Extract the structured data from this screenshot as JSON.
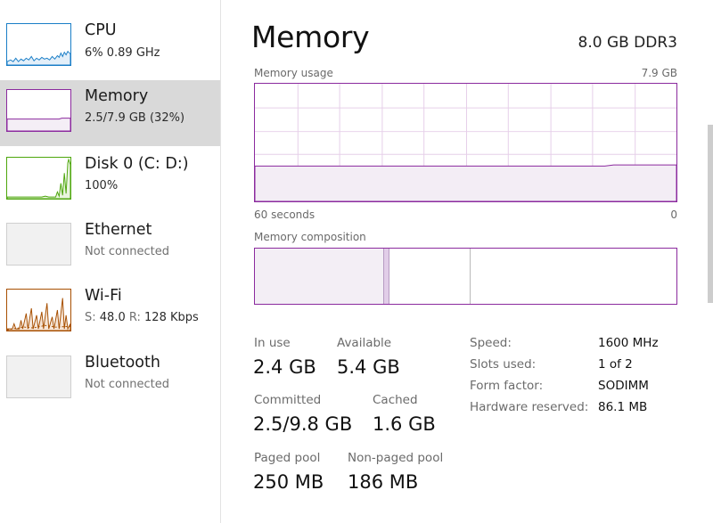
{
  "sidebar": {
    "items": [
      {
        "name": "CPU",
        "sub": "6%  0.89 GHz",
        "color": "#1a7ec7"
      },
      {
        "name": "Memory",
        "sub": "2.5/7.9 GB (32%)",
        "color": "#8b2a9e",
        "selected": true
      },
      {
        "name": "Disk 0 (C: D:)",
        "sub": "100%",
        "color": "#4da60c"
      },
      {
        "name": "Ethernet",
        "sub": "Not connected",
        "color": "#a74f01"
      },
      {
        "name": "Wi-Fi",
        "sub_prefix_s": "S:",
        "sub_s_value": "48.0",
        "sub_prefix_r": "R:",
        "sub_r_value": "128 Kbps",
        "color": "#a74f01"
      },
      {
        "name": "Bluetooth",
        "sub": "Not connected",
        "color": "#a74f01"
      }
    ]
  },
  "main": {
    "title": "Memory",
    "spec": "8.0 GB DDR3",
    "usage_graph": {
      "caption": "Memory usage",
      "max_label": "7.9 GB",
      "time_left": "60 seconds",
      "time_right": "0",
      "fill_fraction_start": 0.3,
      "fill_fraction_end": 0.31,
      "accent": "#8b2a9e"
    },
    "composition": {
      "caption": "Memory composition"
    },
    "stats": {
      "in_use_label": "In use",
      "in_use_value": "2.4 GB",
      "available_label": "Available",
      "available_value": "5.4 GB",
      "committed_label": "Committed",
      "committed_value": "2.5/9.8 GB",
      "cached_label": "Cached",
      "cached_value": "1.6 GB",
      "paged_label": "Paged pool",
      "paged_value": "250 MB",
      "nonpaged_label": "Non-paged pool",
      "nonpaged_value": "186 MB"
    },
    "properties": [
      {
        "label": "Speed:",
        "value": "1600 MHz"
      },
      {
        "label": "Slots used:",
        "value": "1 of 2"
      },
      {
        "label": "Form factor:",
        "value": "SODIMM"
      },
      {
        "label": "Hardware reserved:",
        "value": "86.1 MB"
      }
    ]
  }
}
